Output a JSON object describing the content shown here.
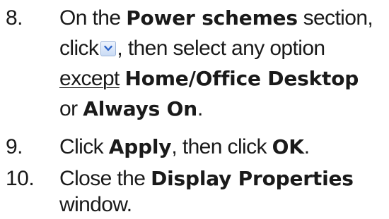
{
  "steps": [
    {
      "number": "8.",
      "line1_pre": "On the",
      "line1_bold": "Power schemes",
      "line1_post": "section,",
      "line2_pre": "click",
      "line2_post": ", then select any option",
      "line3_underlined": "except",
      "line3_bold": "Home/Office Desktop",
      "line4_pre": "or",
      "line4_bold": "Always On",
      "line4_post": "."
    },
    {
      "number": "9.",
      "pre": "Click",
      "bold1": "Apply",
      "mid": ", then click",
      "bold2": "OK",
      "post": "."
    },
    {
      "number": "10.",
      "line1_pre": "Close the",
      "line1_bold": "Display Properties",
      "line2": "window."
    }
  ],
  "icons": {
    "dropdown": "chevron-down-icon"
  },
  "colors": {
    "text": "#1a1a1a",
    "dropdown_arrow": "#2b62c8",
    "dropdown_border": "#9fb6d9"
  }
}
